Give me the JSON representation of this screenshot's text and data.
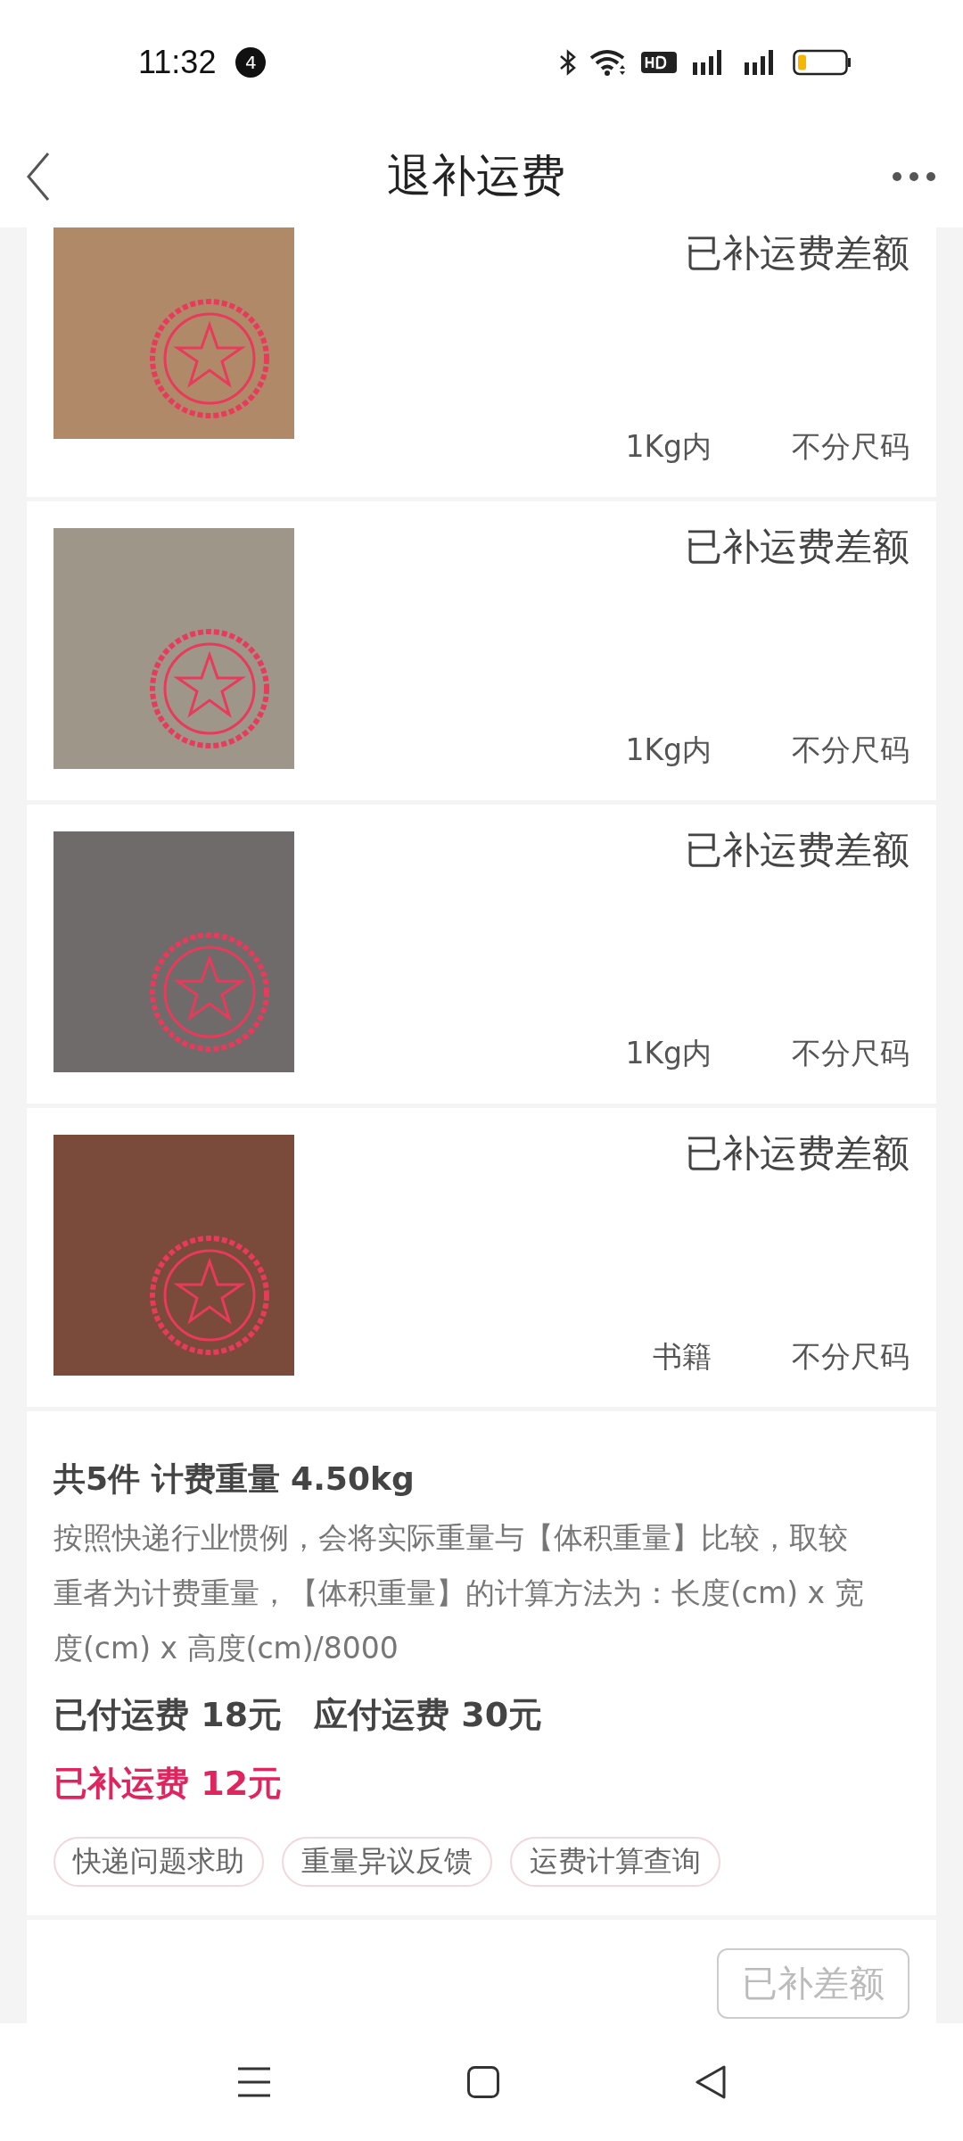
{
  "status_bar": {
    "time": "11:32",
    "notification_count": "4"
  },
  "header": {
    "title": "退补运费"
  },
  "items": [
    {
      "status": "已补运费差额",
      "weight": "1Kg内",
      "size": "不分尺码"
    },
    {
      "status": "已补运费差额",
      "weight": "1Kg内",
      "size": "不分尺码"
    },
    {
      "status": "已补运费差额",
      "weight": "1Kg内",
      "size": "不分尺码"
    },
    {
      "status": "已补运费差额",
      "weight": "书籍",
      "size": "不分尺码"
    }
  ],
  "summary": {
    "heading": "共5件 计费重量 4.50kg",
    "note": "按照快递行业惯例，会将实际重量与【体积重量】比较，取较重者为计费重量，【体积重量】的计算方法为：长度(cm) x 宽度(cm) x 高度(cm)/8000",
    "paid": "已付运费 18元",
    "due": "应付运费 30元",
    "supplemented": "已补运费 12元",
    "tags": [
      "快递问题求助",
      "重量异议反馈",
      "运费计算查询"
    ]
  },
  "action_button": {
    "label": "已补差额",
    "disabled": true
  }
}
